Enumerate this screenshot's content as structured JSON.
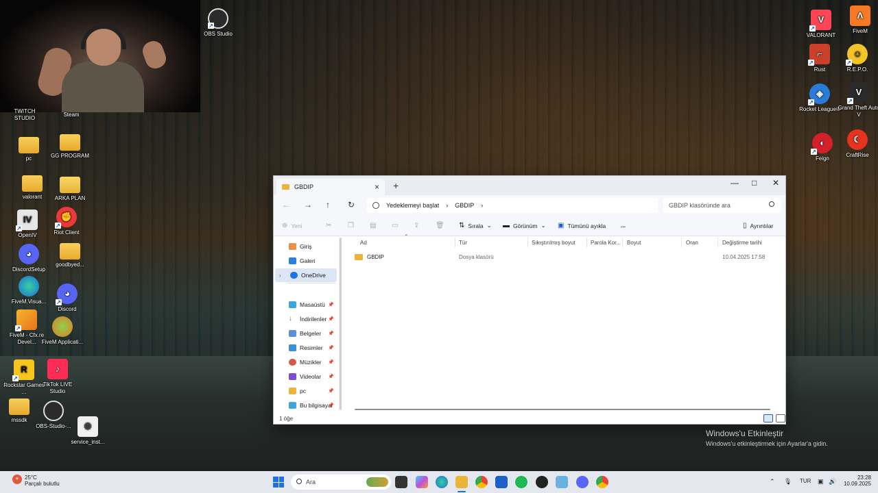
{
  "desktop": {
    "webcam_label": "",
    "icons": [
      {
        "label": "OBS Studio"
      },
      {
        "label": "TWITCH STUDIO"
      },
      {
        "label": "Steam"
      },
      {
        "label": "pc"
      },
      {
        "label": "GG PROGRAM"
      },
      {
        "label": "valorant"
      },
      {
        "label": "ARKA PLAN"
      },
      {
        "label": "OpenIV"
      },
      {
        "label": "Riot Client"
      },
      {
        "label": "DiscordSetup"
      },
      {
        "label": "goodbyed..."
      },
      {
        "label": "FiveM.Visua..."
      },
      {
        "label": "Discord"
      },
      {
        "label": "FiveM - Cfx.re Devel..."
      },
      {
        "label": "FiveM Applicati..."
      },
      {
        "label": "Rockstar Games ..."
      },
      {
        "label": "TikTok LIVE Studio"
      },
      {
        "label": "mssdk"
      },
      {
        "label": "OBS-Studio-..."
      },
      {
        "label": "service_inst..."
      },
      {
        "label": "VALORANT"
      },
      {
        "label": "FiveM"
      },
      {
        "label": "Rust"
      },
      {
        "label": "R.E.P.O."
      },
      {
        "label": "Rocket League®"
      },
      {
        "label": "Grand Theft Auto V"
      },
      {
        "label": "Feign"
      },
      {
        "label": "CraftRise"
      }
    ]
  },
  "explorer": {
    "tab_title": "GBDIP",
    "breadcrumb": [
      "Yedeklemeyi başlat",
      "GBDIP"
    ],
    "search_placeholder": "GBDIP klasöründe ara",
    "toolbar": {
      "new": "Yeni",
      "sort": "Sırala",
      "view": "Görünüm",
      "select_all": "Tümünü ayıkla",
      "more": "...",
      "details": "Ayrıntılar"
    },
    "sidebar": [
      {
        "label": "Giriş"
      },
      {
        "label": "Galeri"
      },
      {
        "label": "OneDrive"
      },
      {
        "label": "Masaüstü"
      },
      {
        "label": "İndirilenler"
      },
      {
        "label": "Belgeler"
      },
      {
        "label": "Resimler"
      },
      {
        "label": "Müzikler"
      },
      {
        "label": "Videolar"
      },
      {
        "label": "pc"
      },
      {
        "label": "Bu bilgisayar"
      }
    ],
    "columns": [
      "Ad",
      "Tür",
      "Sıkıştırılmış boyut",
      "Parola Kor...",
      "Boyut",
      "Oran",
      "Değiştirme tarihi"
    ],
    "rows": [
      {
        "name": "GBDIP",
        "type": "Dosya klasörü",
        "date": "10.04.2025 17:58"
      }
    ],
    "status": "1 öğe"
  },
  "activation": {
    "title": "Windows'u Etkinleştir",
    "subtitle": "Windows'u etkinleştirmek için Ayarlar'a gidin."
  },
  "taskbar": {
    "temperature": "25°C",
    "weather": "Parçalı bulutlu",
    "search_placeholder": "Ara",
    "language": "TUR",
    "time": "23:28",
    "date": "10.09.2025"
  },
  "colors": {
    "accent": "#1f6fe5",
    "folder": "#eab43a",
    "taskbar": "#e4e8ee"
  }
}
